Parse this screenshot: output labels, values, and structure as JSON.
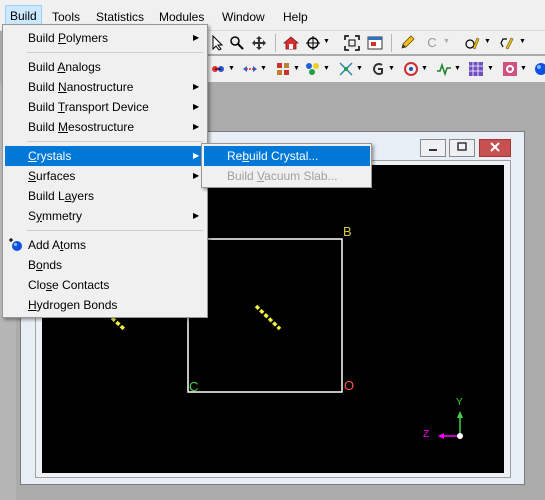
{
  "menubar": {
    "items": [
      "Build",
      "Tools",
      "Statistics",
      "Modules",
      "Window",
      "Help"
    ]
  },
  "build_menu": {
    "items": [
      {
        "label": "Build Polymers",
        "accel": "P"
      },
      {
        "label": "Build Analogs",
        "accel": "A"
      },
      {
        "label": "Build Nanostructure",
        "accel": "N"
      },
      {
        "label": "Build Transport Device",
        "accel": "T"
      },
      {
        "label": "Build Mesostructure",
        "accel": "M"
      },
      {
        "label": "Crystals",
        "accel": "C"
      },
      {
        "label": "Surfaces",
        "accel": "S"
      },
      {
        "label": "Build Layers",
        "accel": "a"
      },
      {
        "label": "Symmetry",
        "accel": "y"
      },
      {
        "label": "Add Atoms",
        "accel": "t"
      },
      {
        "label": "Bonds",
        "accel": "o"
      },
      {
        "label": "Close Contacts",
        "accel": "s"
      },
      {
        "label": "Hydrogen Bonds",
        "accel": "H"
      }
    ]
  },
  "crystals_submenu": {
    "items": [
      {
        "label": "Rebuild Crystal...",
        "accel": "b",
        "enabled": true
      },
      {
        "label": "Build Vacuum Slab...",
        "accel": "V",
        "enabled": false
      }
    ]
  },
  "toolbar_row1": {
    "items": [
      "arrow-cursor-icon",
      "magnify-icon",
      "pan-move-icon",
      "home-view-icon",
      "center-target-icon",
      "fit-screen-icon",
      "window-icon",
      "pencil-icon",
      "carbon-element-icon",
      "sketch-atom-icon",
      "sketch-ring-icon"
    ],
    "element_letter": "C"
  },
  "toolbar_row2": {
    "items": [
      "display-style-icon",
      "measure-icon",
      "lattice-icon",
      "colors-icon",
      "symmetry-icon",
      "dropdown-g-icon",
      "target-icon",
      "pulse-icon",
      "grid-icon",
      "settings-icon",
      "blue-sphere-icon"
    ]
  },
  "document_window": {
    "controls": [
      "minimize",
      "maximize",
      "close"
    ]
  },
  "viewport": {
    "cell_labels": {
      "b": "B",
      "o": "O",
      "c": "C"
    },
    "axes": {
      "y": "Y",
      "z": "Z"
    },
    "colors": {
      "background": "#000000",
      "cell_line": "#ffffff",
      "label_b": "#d4c84a",
      "label_o": "#ff5050",
      "label_c": "#3fd43f",
      "molecule": "#f0f040",
      "axis_y": "#3fd43f",
      "axis_z": "#ff00ff"
    }
  },
  "colors": {
    "highlight": "#0078d7",
    "menu_bg": "#f0f0f0",
    "workspace": "#ababab"
  }
}
